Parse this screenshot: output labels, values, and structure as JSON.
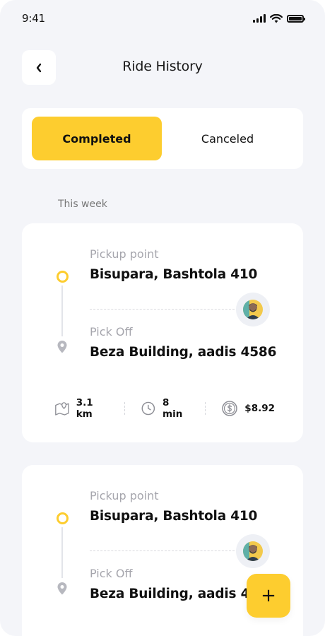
{
  "status_bar": {
    "time": "9:41"
  },
  "header": {
    "title": "Ride History"
  },
  "tabs": {
    "completed_label": "Completed",
    "canceled_label": "Canceled"
  },
  "section": {
    "label": "This week"
  },
  "rides": [
    {
      "pickup_label": "Pickup point",
      "pickup_address": "Bisupara, Bashtola 410",
      "dropoff_label": "Pick Off",
      "dropoff_address": "Beza Building, aadis 4586",
      "distance": "3.1 km",
      "duration": "8 min",
      "price": "$8.92"
    },
    {
      "pickup_label": "Pickup point",
      "pickup_address": "Bisupara, Bashtola 410",
      "dropoff_label": "Pick Off",
      "dropoff_address": "Beza Building, aadis 4586"
    }
  ],
  "fab": {
    "label": "+"
  },
  "colors": {
    "accent": "#fdcd2f",
    "background": "#f4f5f9"
  },
  "icons": [
    "back-arrow-icon",
    "signal-icon",
    "wifi-icon",
    "battery-icon",
    "location-pin-icon",
    "map-icon",
    "clock-icon",
    "dollar-icon",
    "plus-icon"
  ]
}
